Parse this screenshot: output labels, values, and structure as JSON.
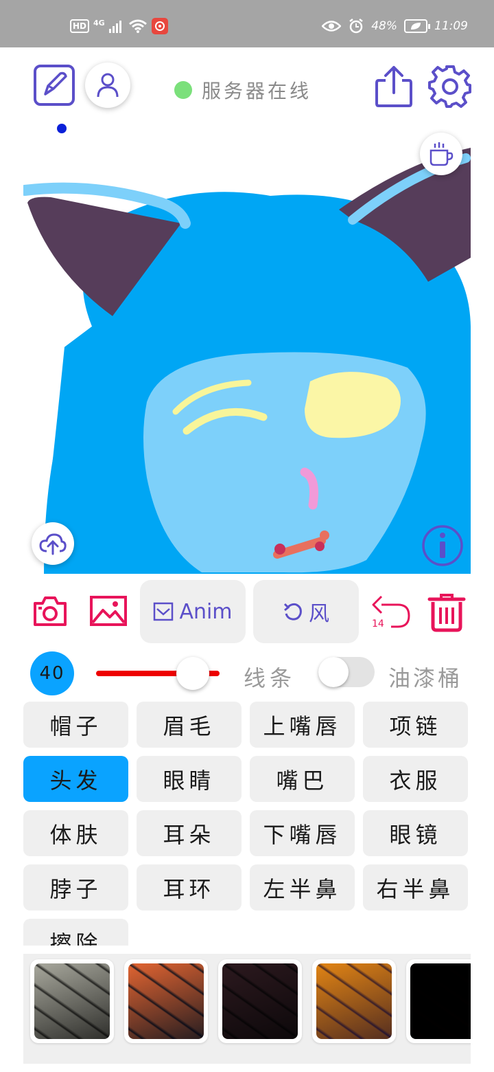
{
  "status_bar": {
    "hd": "HD",
    "network": "4G",
    "battery": "48%",
    "time": "11:09"
  },
  "toolbar": {
    "server_status": "服务器在线",
    "server_color": "#7be07b",
    "accent": "#5b4fc9"
  },
  "tools": {
    "anim_label": "Anim",
    "wind_label": "风",
    "undo_count": "14",
    "danger_color": "#e8145a"
  },
  "brush": {
    "size": "40",
    "slider_fraction": 0.75,
    "line_label": "线条",
    "bucket_label": "油漆桶",
    "bucket_enabled": false
  },
  "parts": [
    {
      "label": "帽子",
      "active": false
    },
    {
      "label": "眉毛",
      "active": false
    },
    {
      "label": "上嘴唇",
      "active": false
    },
    {
      "label": "项链",
      "active": false
    },
    {
      "label": "头发",
      "active": true
    },
    {
      "label": "眼睛",
      "active": false
    },
    {
      "label": "嘴巴",
      "active": false
    },
    {
      "label": "衣服",
      "active": false
    },
    {
      "label": "体肤",
      "active": false
    },
    {
      "label": "耳朵",
      "active": false
    },
    {
      "label": "下嘴唇",
      "active": false
    },
    {
      "label": "眼镜",
      "active": false
    },
    {
      "label": "脖子",
      "active": false
    },
    {
      "label": "耳环",
      "active": false
    },
    {
      "label": "左半鼻",
      "active": false
    },
    {
      "label": "右半鼻",
      "active": false
    },
    {
      "label": "擦除",
      "active": false
    }
  ],
  "textures": [
    {
      "name": "marble-gray",
      "colors": [
        "#cfcfc8",
        "#3a3a38"
      ]
    },
    {
      "name": "marble-orange",
      "colors": [
        "#f0a070",
        "#2a2f4a"
      ]
    },
    {
      "name": "marble-dark",
      "colors": [
        "#6a5058",
        "#1e1a1e"
      ]
    },
    {
      "name": "marble-yellow",
      "colors": [
        "#f0b848",
        "#5a4070"
      ]
    },
    {
      "name": "black",
      "colors": [
        "#050003",
        "#1a0008"
      ]
    }
  ]
}
